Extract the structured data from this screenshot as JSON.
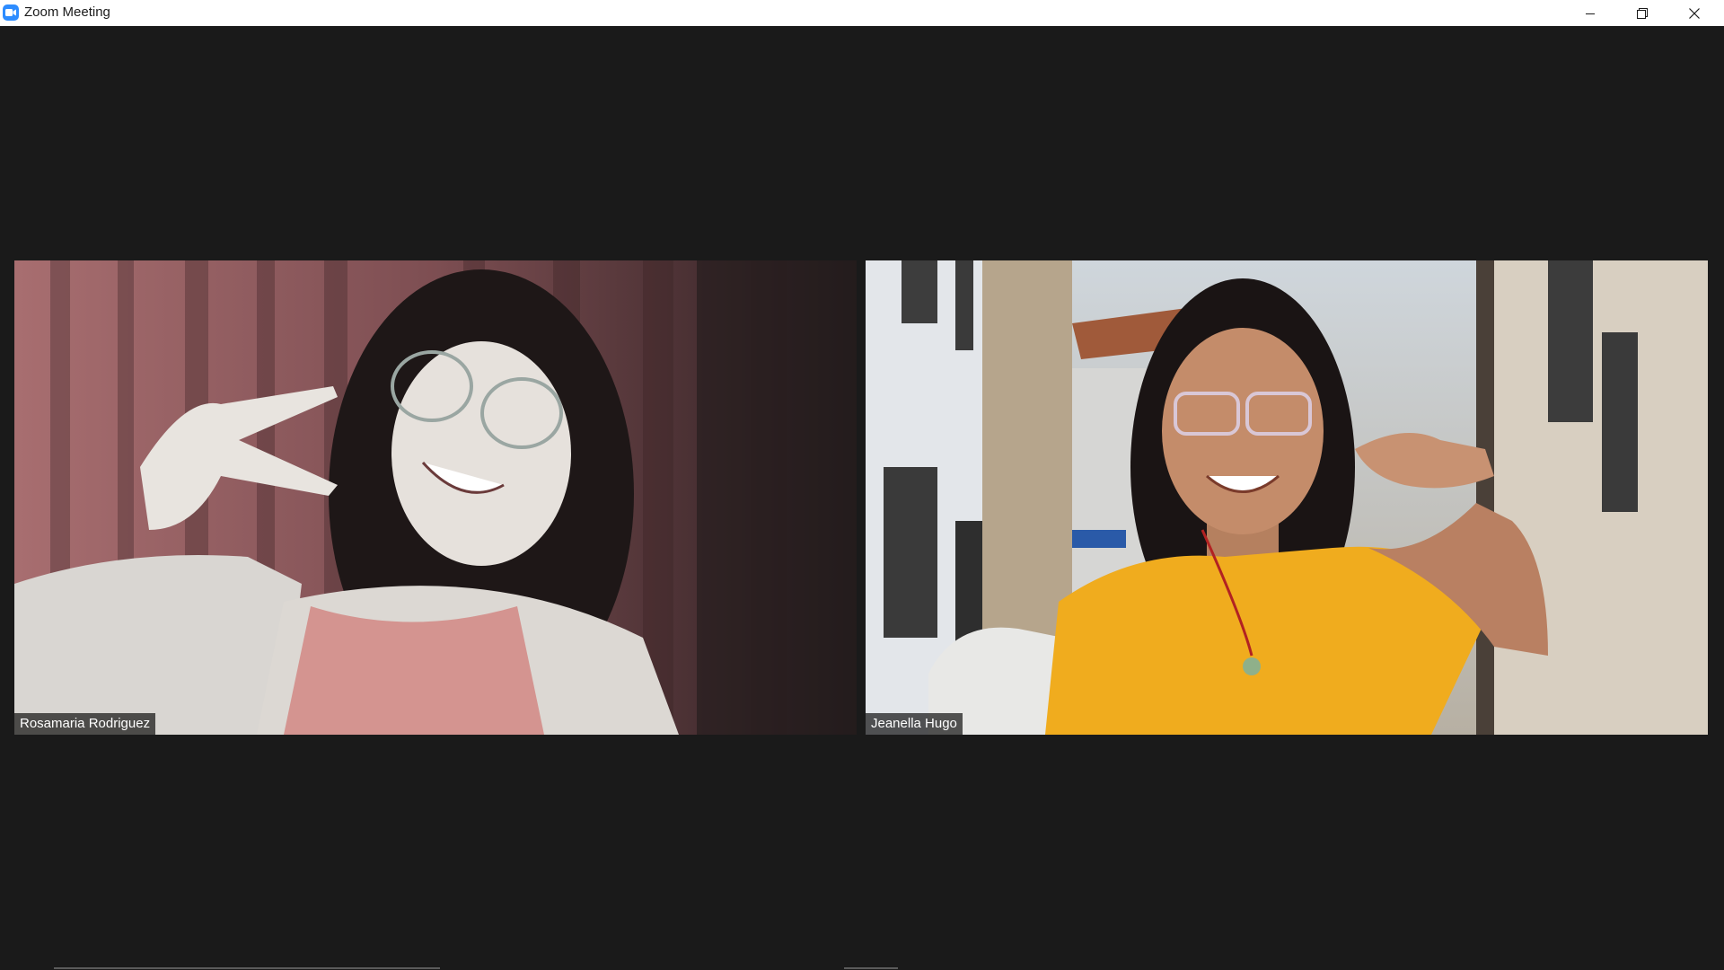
{
  "window": {
    "title": "Zoom Meeting",
    "icon": "zoom-camera-icon",
    "controls": {
      "minimize": "minimize-icon",
      "maximize": "restore-icon",
      "close": "close-icon"
    }
  },
  "colors": {
    "titlebar": "#ffffff",
    "background": "#1a1a1a",
    "brand": "#2d8cff",
    "nametag_bg": "#000000",
    "nametag_text": "#ffffff"
  },
  "participants": [
    {
      "name": "Rosamaria Rodriguez"
    },
    {
      "name": "Jeanella Hugo"
    }
  ]
}
